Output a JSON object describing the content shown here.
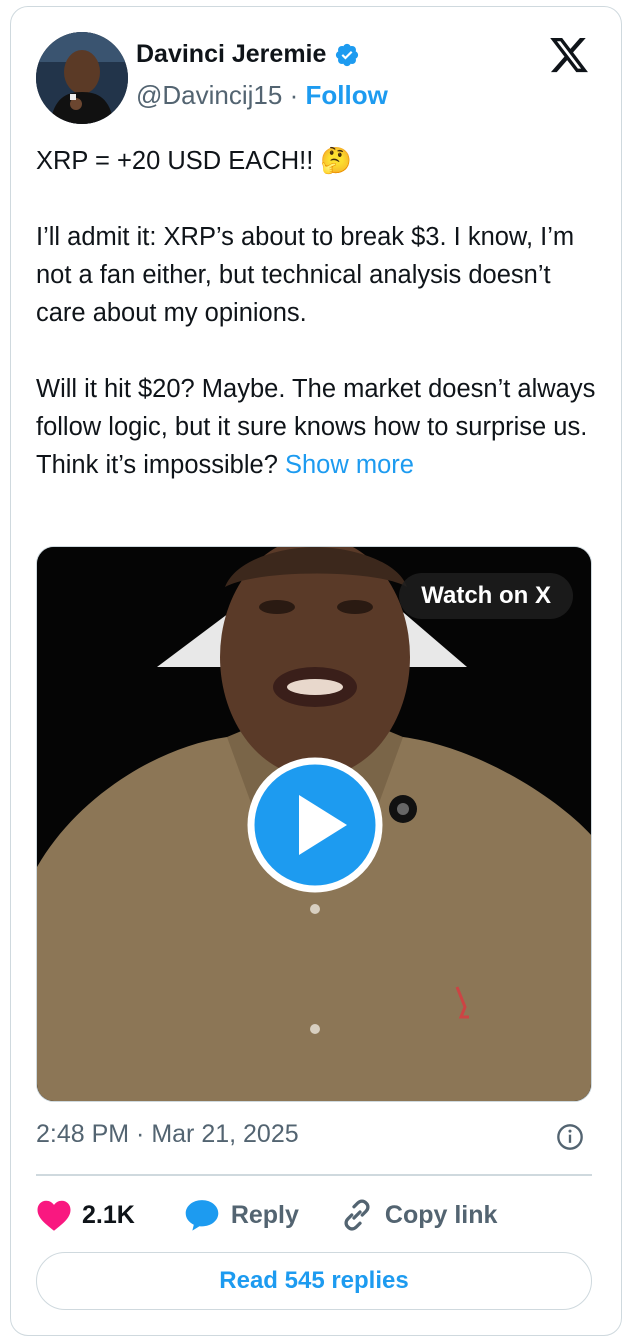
{
  "author": {
    "name": "Davinci Jeremie",
    "handle": "@Davincij15",
    "separator": "·",
    "follow_label": "Follow",
    "verified": true
  },
  "tweet": {
    "line1": "XRP = +20 USD EACH!! 🤔",
    "para2": "I’ll admit it: XRP’s about to break $3. I know, I’m not a fan either, but technical analysis doesn’t care about my opinions.",
    "para3": "Will it hit $20? Maybe. The market doesn’t always follow logic, but it sure knows how to surprise us. Think it’s impossible?",
    "show_more": "Show more"
  },
  "video": {
    "watch_label": "Watch on X"
  },
  "meta": {
    "timestamp": "2:48 PM · Mar 21, 2025"
  },
  "actions": {
    "likes": "2.1K",
    "reply": "Reply",
    "copy_link": "Copy link"
  },
  "read_replies": "Read 545 replies",
  "colors": {
    "accent": "#1d9bf0",
    "heart": "#f91880",
    "text": "#0f1419",
    "muted": "#536471",
    "border": "#cfd9de"
  }
}
